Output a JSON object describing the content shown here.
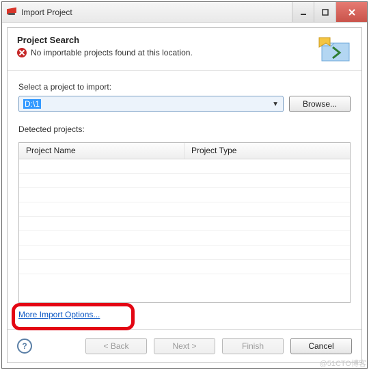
{
  "window": {
    "title": "Import Project"
  },
  "banner": {
    "title": "Project Search",
    "error_message": "No importable projects found at this location."
  },
  "select_label": "Select a project to import:",
  "path_value": "D:\\1",
  "browse_label": "Browse...",
  "detected_label": "Detected projects:",
  "table": {
    "col1": "Project Name",
    "col2": "Project Type"
  },
  "link": "More Import Options...",
  "buttons": {
    "back": "< Back",
    "next": "Next >",
    "finish": "Finish",
    "cancel": "Cancel"
  },
  "help_glyph": "?",
  "watermark": "@51CTO博客"
}
